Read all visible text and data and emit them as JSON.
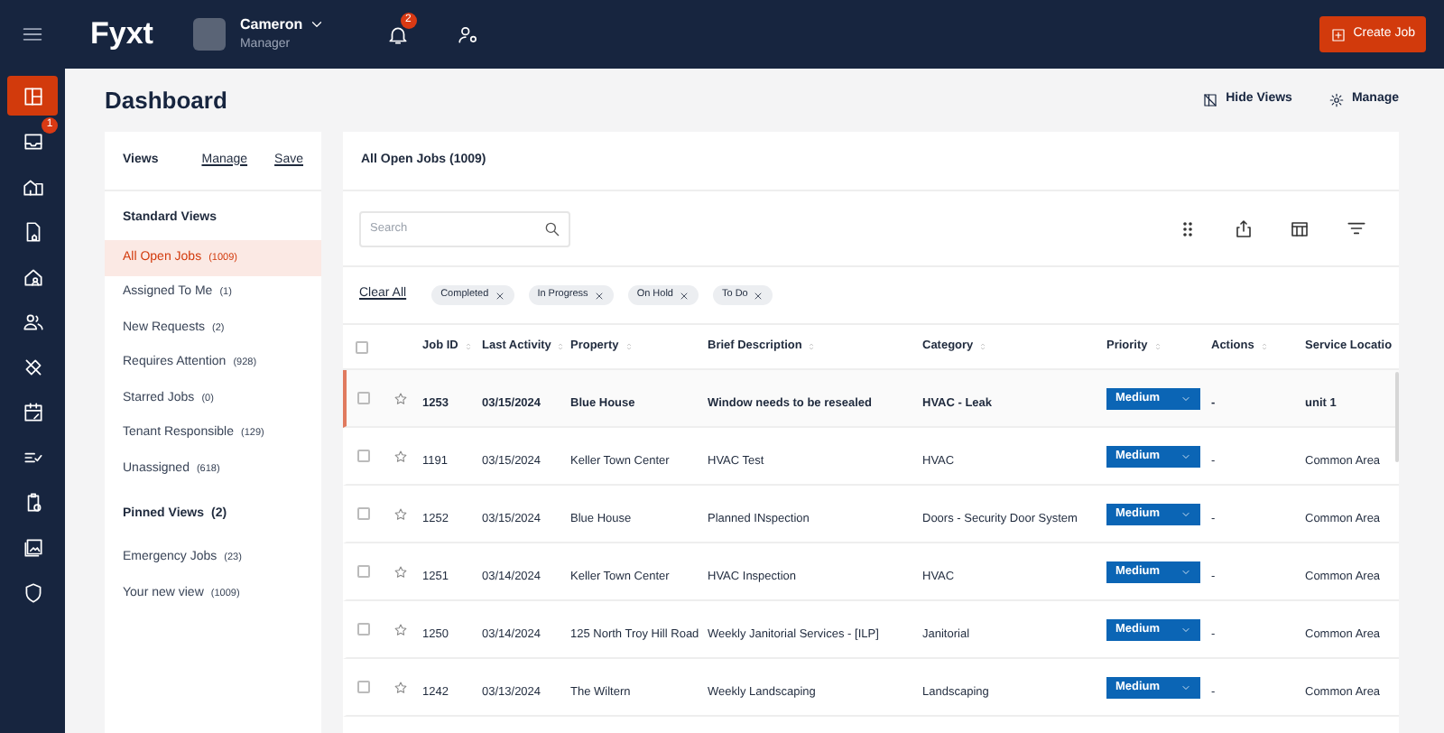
{
  "topbar": {
    "logo": "Fyxt",
    "user": {
      "name": "Cameron",
      "role": "Manager"
    },
    "notification_count": "2",
    "create_button": "Create Job"
  },
  "rail": [
    {
      "selected": true
    },
    {
      "selected": false,
      "badge": "1"
    },
    {
      "selected": false
    },
    {
      "selected": false
    },
    {
      "selected": false
    },
    {
      "selected": false
    },
    {
      "selected": false
    },
    {
      "selected": false
    },
    {
      "selected": false
    },
    {
      "selected": false
    },
    {
      "selected": false
    },
    {
      "selected": false
    }
  ],
  "page": {
    "title": "Dashboard",
    "actions": [
      "Hide Views",
      "Manage"
    ]
  },
  "views": {
    "title": "Views",
    "links": [
      "Manage",
      "Save"
    ],
    "sections": [
      {
        "title": "Standard Views",
        "items": [
          {
            "label": "All Open Jobs",
            "count": "(1009)",
            "selected": true
          },
          {
            "label": "Assigned To Me",
            "count": "(1)",
            "selected": false
          },
          {
            "label": "New Requests",
            "count": "(2)",
            "selected": false
          },
          {
            "label": "Requires Attention",
            "count": "(928)",
            "selected": false
          },
          {
            "label": "Starred Jobs",
            "count": "(0)",
            "selected": false
          },
          {
            "label": "Tenant Responsible",
            "count": "(129)",
            "selected": false
          },
          {
            "label": "Unassigned",
            "count": "(618)",
            "selected": false
          }
        ]
      },
      {
        "title": "Pinned Views",
        "count": "(2)",
        "items": [
          {
            "label": "Emergency Jobs",
            "count": "(23)",
            "selected": false
          },
          {
            "label": "Your new view",
            "count": "(1009)",
            "selected": false
          }
        ]
      }
    ]
  },
  "jobs": {
    "title": "All Open Jobs (1009)",
    "all_checked": false,
    "search": {
      "placeholder": "Search"
    },
    "clear_all": "Clear All",
    "filters": [
      "Completed",
      "In Progress",
      "On Hold",
      "To Do"
    ],
    "columns": [
      "Job ID",
      "Last Activity",
      "Property",
      "Brief Description",
      "Category",
      "Priority",
      "Actions",
      "Service Locatio"
    ],
    "rows": [
      {
        "selected": true,
        "checked": false,
        "starred": false,
        "cells": [
          "1253",
          "03/15/2024",
          "Blue House",
          "Window needs to be resealed",
          "HVAC - Leak",
          "Medium",
          "-",
          "unit 1"
        ]
      },
      {
        "selected": false,
        "checked": false,
        "starred": false,
        "cells": [
          "1191",
          "03/15/2024",
          "Keller Town Center",
          "HVAC Test",
          "HVAC",
          "Medium",
          "-",
          "Common Area"
        ]
      },
      {
        "selected": false,
        "checked": false,
        "starred": false,
        "cells": [
          "1252",
          "03/15/2024",
          "Blue House",
          "Planned INspection",
          "Doors - Security Door System",
          "Medium",
          "-",
          "Common Area"
        ]
      },
      {
        "selected": false,
        "checked": false,
        "starred": false,
        "cells": [
          "1251",
          "03/14/2024",
          "Keller Town Center",
          "HVAC Inspection",
          "HVAC",
          "Medium",
          "-",
          "Common Area"
        ]
      },
      {
        "selected": false,
        "checked": false,
        "starred": false,
        "cells": [
          "1250",
          "03/14/2024",
          "125 North Troy Hill Road",
          "Weekly Janitorial Services - [ILP]",
          "Janitorial",
          "Medium",
          "-",
          "Common Area"
        ]
      },
      {
        "selected": false,
        "checked": false,
        "starred": false,
        "cells": [
          "1242",
          "03/13/2024",
          "The Wiltern",
          "Weekly Landscaping",
          "Landscaping",
          "Medium",
          "-",
          "Common Area"
        ]
      }
    ]
  }
}
